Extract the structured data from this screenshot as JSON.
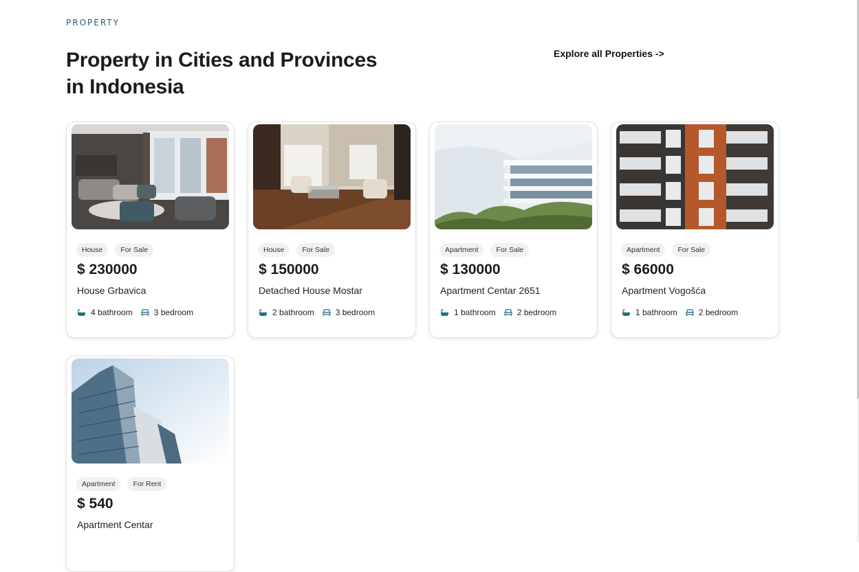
{
  "section": {
    "eyebrow": "PROPERTY",
    "title": "Property in Cities and Provinces in Indonesia",
    "explore_link": "Explore all Properties ->"
  },
  "colors": {
    "accent": "#1f6f85",
    "eyebrow": "#1f5f73",
    "tag_bg": "#f1f1f1"
  },
  "properties": [
    {
      "type": "House",
      "status": "For Sale",
      "price": "$ 230000",
      "name": "House Grbavica",
      "bathrooms": "4 bathroom",
      "bedrooms": "3 bedroom",
      "image": "living-room-photo"
    },
    {
      "type": "House",
      "status": "For Sale",
      "price": "$ 150000",
      "name": "Detached House Mostar",
      "bathrooms": "2 bathroom",
      "bedrooms": "3 bedroom",
      "image": "wood-floor-living-room-photo"
    },
    {
      "type": "Apartment",
      "status": "For Sale",
      "price": "$ 130000",
      "name": "Apartment Centar 2651",
      "bathrooms": "1 bathroom",
      "bedrooms": "2 bedroom",
      "image": "white-apartment-building-photo"
    },
    {
      "type": "Apartment",
      "status": "For Sale",
      "price": "$ 66000",
      "name": "Apartment Vogošća",
      "bathrooms": "1 bathroom",
      "bedrooms": "2 bedroom",
      "image": "brick-apartment-facade-photo"
    },
    {
      "type": "Apartment",
      "status": "For Rent",
      "price": "$ 540",
      "name": "Apartment Centar",
      "bathrooms": "",
      "bedrooms": "",
      "image": "glass-tower-photo"
    }
  ]
}
